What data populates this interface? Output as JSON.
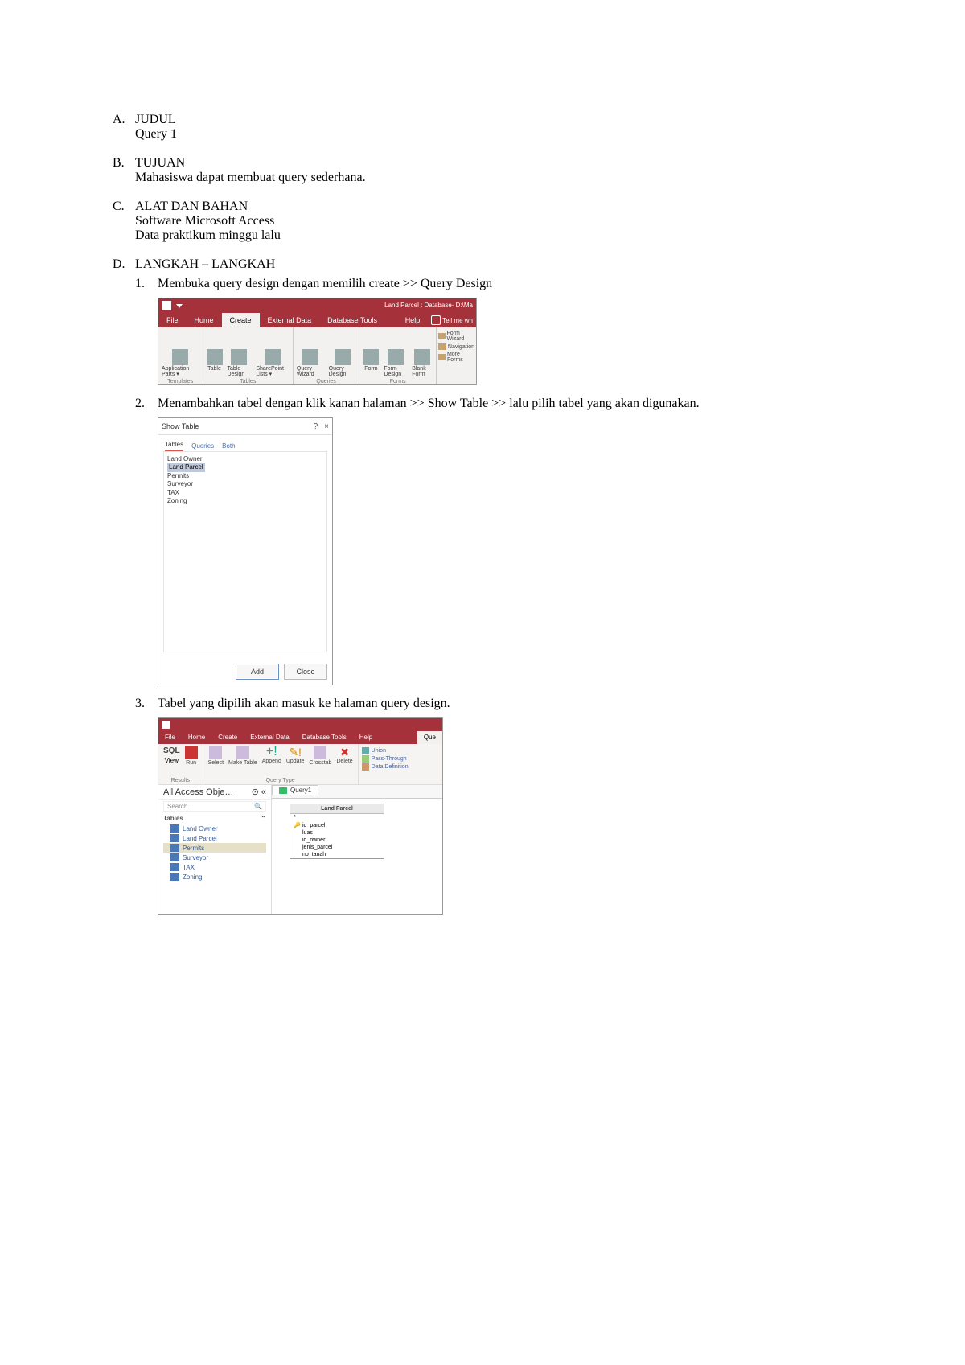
{
  "sections": {
    "a": {
      "letter": "A.",
      "title": "JUDUL",
      "body": "Query 1"
    },
    "b": {
      "letter": "B.",
      "title": "TUJUAN",
      "body": "Mahasiswa dapat membuat query sederhana."
    },
    "c": {
      "letter": "C.",
      "title": "ALAT DAN BAHAN",
      "body1": "Software Microsoft Access",
      "body2": "Data praktikum minggu lalu"
    },
    "d": {
      "letter": "D.",
      "title": "LANGKAH – LANGKAH"
    }
  },
  "steps": {
    "s1": {
      "num": "1.",
      "text": "Membuka query design dengan memilih create >> Query Design"
    },
    "s2": {
      "num": "2.",
      "text": "Menambahkan tabel dengan klik kanan halaman >> Show Table >> lalu pilih tabel yang akan digunakan."
    },
    "s3": {
      "num": "3.",
      "text": "Tabel yang dipilih akan masuk ke halaman query design."
    }
  },
  "ss1": {
    "title": "Land Parcel : Database- D:\\Ma",
    "tabs": {
      "file": "File",
      "home": "Home",
      "create": "Create",
      "ext": "External Data",
      "db": "Database Tools",
      "help": "Help",
      "tell": "Tell me wh"
    },
    "templates": {
      "appparts": "Application Parts ▾",
      "label": "Templates"
    },
    "tables": {
      "table": "Table",
      "design": "Table Design",
      "sp": "SharePoint Lists ▾",
      "label": "Tables"
    },
    "queries": {
      "wiz": "Query Wizard",
      "des": "Query Design",
      "label": "Queries"
    },
    "forms": {
      "form": "Form",
      "fdes": "Form Design",
      "blank": "Blank Form",
      "wiz": "Form Wizard",
      "nav": "Navigation",
      "more": "More Forms",
      "label": "Forms"
    }
  },
  "ss2": {
    "title": "Show Table",
    "close_help": "?",
    "close_x": "×",
    "tab_tables": "Tables",
    "tab_queries": "Queries",
    "tab_both": "Both",
    "items": {
      "i0": "Land Owner",
      "i1": "Land Parcel",
      "i2": "Permits",
      "i3": "Surveyor",
      "i4": "TAX",
      "i5": "Zoning"
    },
    "btn_add": "Add",
    "btn_close": "Close"
  },
  "ss3": {
    "tabs": {
      "file": "File",
      "home": "Home",
      "create": "Create",
      "ext": "External Data",
      "db": "Database Tools",
      "help": "Help",
      "design": "Que"
    },
    "results": {
      "sql": "SQL",
      "view": "View",
      "run": "Run",
      "label": "Results"
    },
    "qtype": {
      "select": "Select",
      "make": "Make Table",
      "append": "Append",
      "update": "Update",
      "cross": "Crosstab",
      "delete": "Delete",
      "label": "Query Type"
    },
    "side": {
      "union": "Union",
      "pass": "Pass-Through",
      "datadef": "Data Definition"
    },
    "navhdr": "All Access Obje…",
    "search": "Search...",
    "tablesHd": "Tables",
    "navitems": {
      "n0": "Land Owner",
      "n1": "Land Parcel",
      "n2": "Permits",
      "n3": "Surveyor",
      "n4": "TAX",
      "n5": "Zoning"
    },
    "doctab": "Query1",
    "tbl_title": "Land Parcel",
    "tbl_fields": {
      "f0": "*",
      "f1": "id_parcel",
      "f2": "luas",
      "f3": "id_owner",
      "f4": "jenis_parcel",
      "f5": "no_tanah"
    }
  }
}
